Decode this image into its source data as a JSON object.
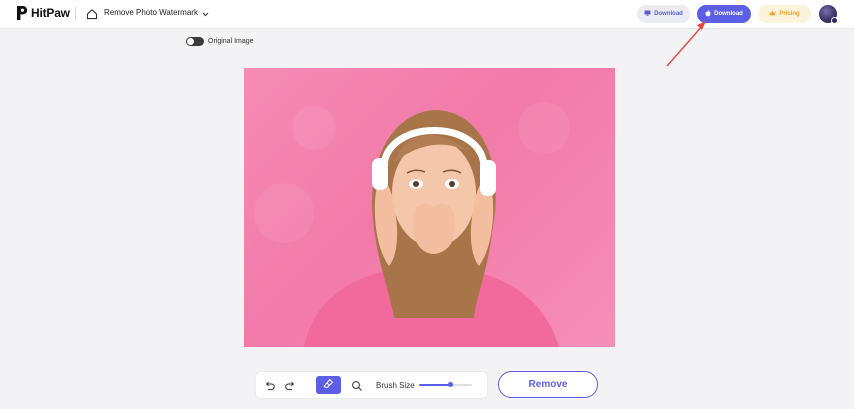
{
  "header": {
    "brand": "HitPaw",
    "tool": "Remove Photo Watermark",
    "buttons": {
      "download_desktop": "Download",
      "download": "Download",
      "pricing": "Pricing"
    },
    "icons": {
      "logo": "hitpaw-logo-icon",
      "home": "home-icon",
      "chevron": "chevron-down-icon",
      "monitor": "monitor-icon",
      "apple": "apple-icon",
      "crown": "crown-icon"
    }
  },
  "view": {
    "toggle_label": "Original Image",
    "toggle_on": false
  },
  "toolbar": {
    "brush_label": "Brush Size",
    "brush_size": 0.6,
    "icons": [
      "undo-icon",
      "redo-icon",
      "eraser-icon",
      "zoom-icon"
    ]
  },
  "actions": {
    "remove": "Remove"
  },
  "colors": {
    "accent": "#5c5fe6",
    "pricing": "#e8a21c",
    "annotation_arrow": "#e8453c"
  }
}
